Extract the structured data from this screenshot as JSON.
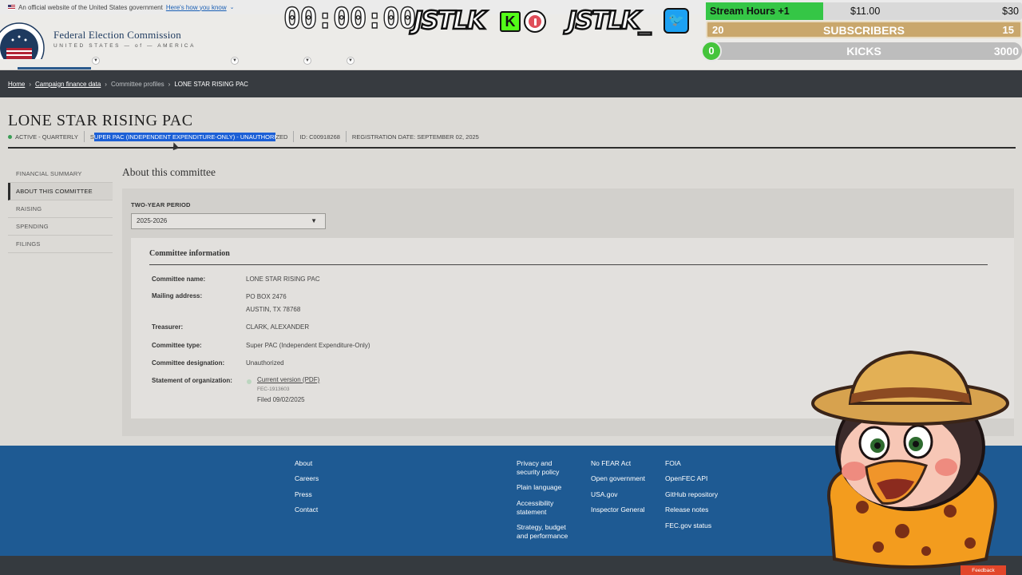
{
  "gov_banner": {
    "text": "An official website of the United States government",
    "link": "Here's how you know"
  },
  "header": {
    "logo_title": "Federal Election Commission",
    "logo_sub": "UNITED STATES — of — AMERICA"
  },
  "overlay": {
    "timer": "00:00:00",
    "brand_kick": "JSTLK",
    "kick_letter": "K",
    "brand_twitter": "JSTLK_",
    "twitter_glyph": "🐦",
    "stream_hours": {
      "label": "Stream Hours +1",
      "current": "$11.00",
      "goal": "$30",
      "progress": 0.37
    },
    "subscribers": {
      "left": "20",
      "label": "SUBSCRIBERS",
      "right": "15"
    },
    "kicks": {
      "left": "0",
      "label": "KICKS",
      "right": "3000"
    }
  },
  "breadcrumb": {
    "home": "Home",
    "campaign": "Campaign finance data",
    "profiles": "Committee profiles",
    "current": "LONE STAR RISING PAC",
    "sep": "›"
  },
  "committee": {
    "name": "LONE STAR RISING PAC",
    "status": "ACTIVE - QUARTERLY",
    "type_prefix": "S",
    "type_highlight": "UPER PAC (INDEPENDENT EXPENDITURE-ONLY) - UNAUTHORI",
    "type_suffix": "ZED",
    "id": "ID: C00918268",
    "registration": "REGISTRATION DATE: SEPTEMBER 02, 2025"
  },
  "side_nav": [
    "FINANCIAL SUMMARY",
    "ABOUT THIS COMMITTEE",
    "RAISING",
    "SPENDING",
    "FILINGS"
  ],
  "about": {
    "title": "About this committee",
    "period_label": "TWO-YEAR PERIOD",
    "period_value": "2025-2026",
    "period_caret": "▼",
    "info_title": "Committee information",
    "rows": {
      "name_label": "Committee name:",
      "name_value": "LONE STAR RISING PAC",
      "address_label": "Mailing address:",
      "address_line1": "PO BOX 2476",
      "address_line2": "AUSTIN, TX 78768",
      "treasurer_label": "Treasurer:",
      "treasurer_value": "CLARK, ALEXANDER",
      "type_label": "Committee type:",
      "type_value": "Super PAC (Independent Expenditure-Only)",
      "designation_label": "Committee designation:",
      "designation_value": "Unauthorized",
      "statement_label": "Statement of organization:",
      "statement_link": "Current version (PDF)",
      "statement_id": "FEC-1913603",
      "statement_filed": "Filed 09/02/2025"
    }
  },
  "footer": {
    "col1": [
      "About",
      "Careers",
      "Press",
      "Contact"
    ],
    "col2": [
      "Privacy and\nsecurity policy",
      "Plain language",
      "Accessibility\nstatement",
      "Strategy, budget\nand performance"
    ],
    "col3": [
      "No FEAR Act",
      "Open government",
      "USA.gov",
      "Inspector General"
    ],
    "col4": [
      "FOIA",
      "OpenFEC API",
      "GitHub repository",
      "Release notes",
      "FEC.gov status"
    ],
    "feedback": "Feedback"
  },
  "colors": {
    "footer_bg": "#1e5a93",
    "crumb_bg": "#373b40",
    "highlight": "#1b5fd6",
    "kick_green": "#53fc18",
    "twitter_blue": "#1da1f2"
  }
}
